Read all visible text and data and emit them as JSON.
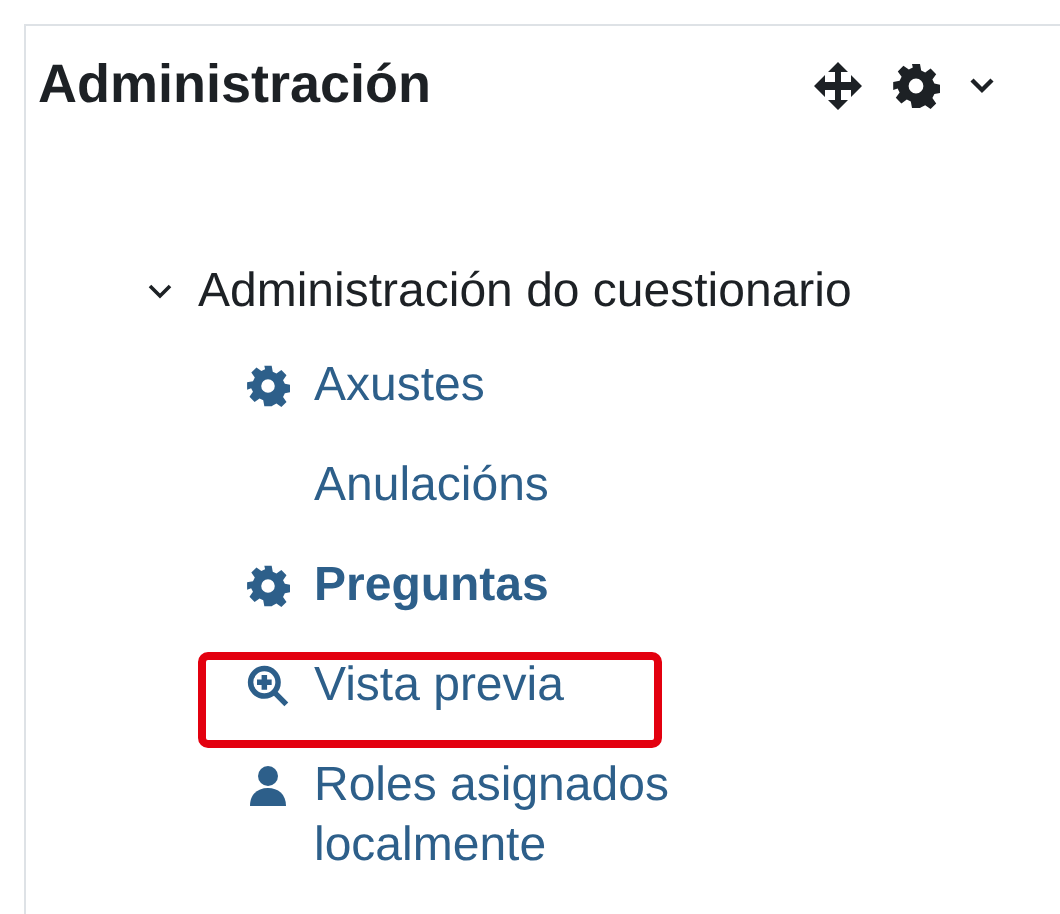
{
  "block": {
    "title": "Administración"
  },
  "tree": {
    "label": "Administración do cuestionario",
    "expanded": true,
    "children": [
      {
        "label": "Axustes",
        "kind": "gear",
        "current": false,
        "highlighted": false
      },
      {
        "label": "Anulacións",
        "kind": "plain",
        "current": false,
        "highlighted": false
      },
      {
        "label": "Preguntas",
        "kind": "gear",
        "current": true,
        "highlighted": false
      },
      {
        "label": "Vista previa",
        "kind": "zoom",
        "current": false,
        "highlighted": true
      },
      {
        "label": "Roles asignados localmente",
        "kind": "person",
        "current": false,
        "highlighted": false
      }
    ]
  }
}
